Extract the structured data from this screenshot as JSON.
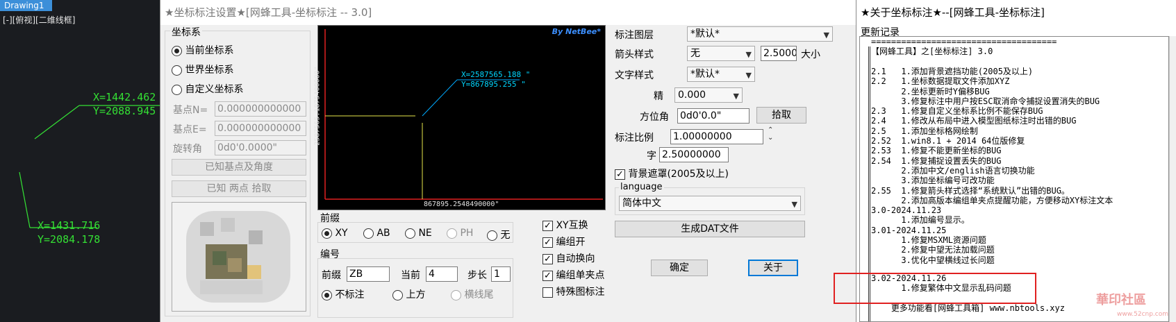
{
  "cad": {
    "tab": "Drawing1",
    "view_label": "[-][俯视][二维线框]",
    "coord1_x": "X=1442.462",
    "coord1_y": "Y=2088.945",
    "coord2_x": "X=1431.716",
    "coord2_y": "Y=2084.178",
    "line_color": "#34e034"
  },
  "dialog": {
    "title": "★坐标标注设置★[网蜂工具-坐标标注 -- 3.0]",
    "coord_system": {
      "label": "坐标系",
      "options": [
        "当前坐标系",
        "世界坐标系",
        "自定义坐标系"
      ],
      "selected": "当前坐标系",
      "base_n_label": "基点N=",
      "base_n_value": "0.000000000000",
      "base_e_label": "基点E=",
      "base_e_value": "0.000000000000",
      "rotate_label": "旋转角",
      "rotate_value": "0d0'0.0000\"",
      "btn_known_angle": "已知基点及角度",
      "btn_two_points": "已知 两点 拾取"
    },
    "preview": {
      "brand": "By NetBee*",
      "label_x": "X=2587565.188 \"",
      "label_y": "Y=867895.255 \"",
      "axis_vertical": "2587565.1875400000\"",
      "axis_horizontal": "867895.2548490000\"",
      "label_color": "#00d6ff",
      "leader_color": "#00aaff",
      "axis_color": "#e02020",
      "guide_color": "#e8e84a"
    },
    "prefix": {
      "label": "前缀",
      "options": [
        "XY",
        "AB",
        "NE",
        "PH",
        "无"
      ],
      "selected": "XY",
      "disabled": "PH"
    },
    "numbering": {
      "label": "编号",
      "prefix_label": "前缀",
      "prefix_value": "ZB",
      "current_label": "当前",
      "current_value": "4",
      "step_label": "步长",
      "step_value": "1",
      "options": [
        "不标注",
        "上方",
        "横线尾"
      ],
      "selected": "不标注",
      "disabled": "横线尾"
    },
    "checks": [
      {
        "label": "XY互换",
        "checked": true
      },
      {
        "label": "编组开",
        "checked": true
      },
      {
        "label": "自动换向",
        "checked": true
      },
      {
        "label": "编组单夹点",
        "checked": true
      },
      {
        "label": "特殊图标注",
        "checked": false
      }
    ],
    "right": {
      "layer_label": "标注图层",
      "layer_value": "*默认*",
      "arrow_label": "箭头样式",
      "arrow_value": "无",
      "arrow_size_value": "2.5000",
      "arrow_size_label": "大小",
      "text_label": "文字样式",
      "text_value": "*默认*",
      "precision_label": "精",
      "precision_value": "0.000",
      "azimuth_label": "方位角",
      "azimuth_value": "0d0'0.0\"",
      "pick_btn": "拾取",
      "scale_label": "标注比例",
      "scale_value": "1.00000000",
      "char_label": "字",
      "char_value": "2.50000000",
      "mask_label": "背景遮罩(2005及以上)",
      "language_label": "language",
      "language_value": "简体中文",
      "gen_dat_btn": "生成DAT文件",
      "ok_btn": "确定",
      "about_btn": "关于"
    }
  },
  "about": {
    "title": "★关于坐标标注★--[网蜂工具-坐标标注]",
    "subtitle": "更新记录",
    "lines": [
      "=====================================",
      "【网蜂工具】之[坐标标注] 3.0",
      "",
      "2.1   1.添加背景遮挡功能(2005及以上)",
      "2.2   1.坐标数据提取文件添加XYZ",
      "      2.坐标更新时Y偏移BUG",
      "      3.修复标注中用户按ESC取消命令捕捉设置消失的BUG",
      "2.3   1.修复自定义坐标系比例不能保存BUG",
      "2.4   1.修改从布局中进入模型图纸标注时出错的BUG",
      "2.5   1.添加坐标格网绘制",
      "2.52  1.win8.1 + 2014 64位版修复",
      "2.53  1.修复不能更新坐标的BUG",
      "2.54  1.修复捕捉设置丢失的BUG",
      "      2.添加中文/english语言切换功能",
      "      3.添加坐标编号可改功能",
      "2.55  1.修复箭头样式选择“系统默认”出错的BUG。",
      "      2.添加高版本编组单夹点提醒功能，方便移动XY标注文本",
      "3.0-2024.11.23",
      "      1.添加编号显示。",
      "3.01-2024.11.25",
      "      1.修复MSXML资源问题",
      "      2.修复中望无法加载问题",
      "      3.优化中望横线过长问题",
      "3.02-2024.11.26",
      "      1.修复繁体中文显示乱码问题",
      "",
      "    更多功能看[网蜂工具箱] www.nbtools.xyz"
    ],
    "highlight_color": "#e02020"
  },
  "watermark": {
    "text": "華印社區",
    "url": "www.52cnp.com"
  }
}
